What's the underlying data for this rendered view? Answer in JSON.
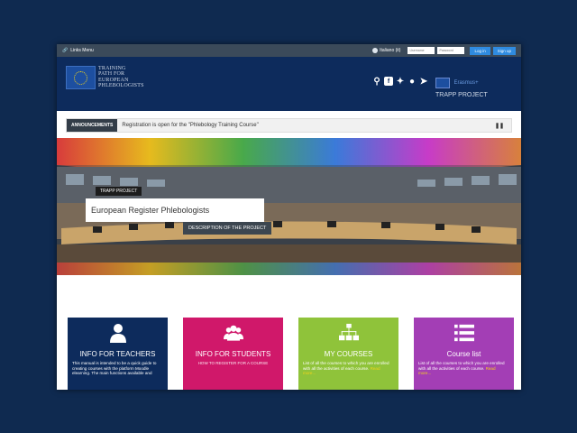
{
  "topbar": {
    "links_menu": "Links Menu",
    "language": "Italiano (it)",
    "username_placeholder": "Username",
    "password_placeholder": "Password",
    "login_label": "Log in",
    "signup_label": "Sign up"
  },
  "header": {
    "logo_lines": [
      "TRAINING",
      "PATH FOR",
      "EUROPEAN",
      "PHLEBOLOGISTS"
    ],
    "erasmus_label": "Erasmus+",
    "project_label": "TRAPP PROJECT",
    "icons": [
      "search-icon",
      "facebook-icon",
      "twitter-icon",
      "globe-icon",
      "login-icon"
    ]
  },
  "announcement": {
    "label": "ANNOUNCEMENTS",
    "text": "Registration is open for the \"Phlebology Training Course\""
  },
  "hero": {
    "tag": "TRAPP PROJECT",
    "title": "European Register Phlebologists",
    "button": "DESCRIPTION OF THE PROJECT"
  },
  "cards": [
    {
      "title": "INFO FOR TEACHERS",
      "subtitle": "",
      "body": "This manual is intended to be a quick guide to creating courses with the platform Moodle elearning. The main functions available and",
      "more": "",
      "icon": "person-icon",
      "color": "#0d2b5c"
    },
    {
      "title": "INFO FOR STUDENTS",
      "subtitle": "HOW TO REGISTER FOR A COURSE",
      "body": "",
      "more": "",
      "icon": "group-icon",
      "color": "#d0186a"
    },
    {
      "title": "MY COURSES",
      "subtitle": "",
      "body": "List of all the courses to which you are enrolled with all the activities of each course.",
      "more": "Read more...",
      "icon": "hierarchy-icon",
      "color": "#8fc33a"
    },
    {
      "title": "Course list",
      "subtitle": "",
      "body": "List of all the courses to which you are enrolled with all the activities of each course.",
      "more": "Read more...",
      "icon": "list-icon",
      "color": "#a33eb5"
    }
  ]
}
